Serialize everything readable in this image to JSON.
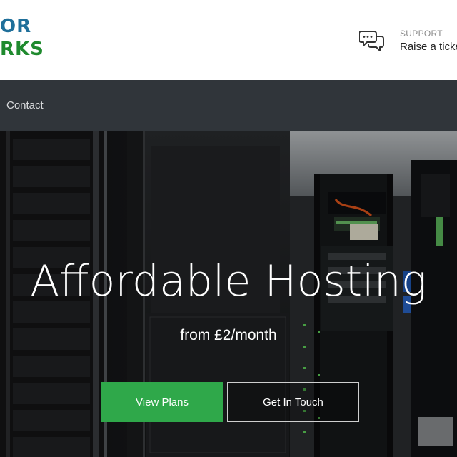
{
  "header": {
    "logo": {
      "line1": "OR",
      "line2": "RKS"
    },
    "support": {
      "icon": "chat-bubbles-icon",
      "label": "SUPPORT",
      "text": "Raise a ticket"
    }
  },
  "nav": {
    "items": [
      {
        "label": "Contact"
      }
    ]
  },
  "hero": {
    "title": "Affordable Hosting",
    "subtitle": "from £2/month",
    "primary_button": "View Plans",
    "secondary_button": "Get In Touch"
  },
  "colors": {
    "nav_bg": "#30353a",
    "primary_button": "#2fa84a",
    "logo_blue": "#1f6f9a",
    "logo_green": "#1f8a2e"
  }
}
